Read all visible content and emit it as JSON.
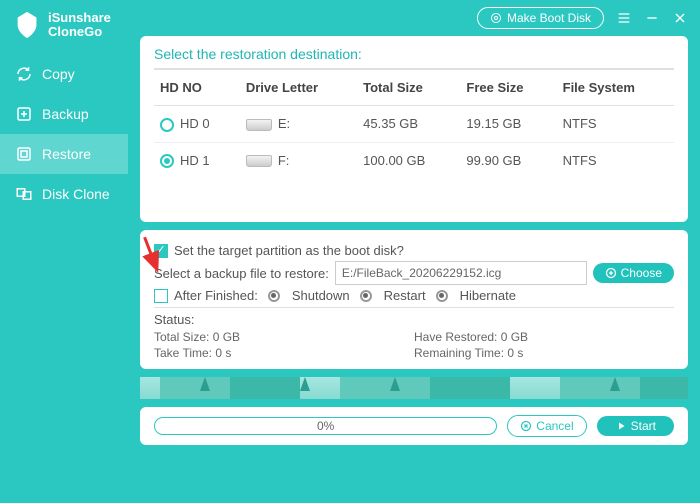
{
  "brand": {
    "line1": "iSunshare",
    "line2": "CloneGo"
  },
  "titlebar": {
    "make_boot": "Make Boot Disk"
  },
  "sidebar": {
    "items": [
      {
        "label": "Copy"
      },
      {
        "label": "Backup"
      },
      {
        "label": "Restore"
      },
      {
        "label": "Disk Clone"
      }
    ]
  },
  "dest_panel": {
    "title": "Select the restoration destination:",
    "columns": [
      "HD NO",
      "Drive Letter",
      "Total Size",
      "Free Size",
      "File System"
    ],
    "rows": [
      {
        "hd": "HD 0",
        "letter": "E:",
        "total": "45.35 GB",
        "free": "19.15 GB",
        "fs": "NTFS",
        "selected": false
      },
      {
        "hd": "HD 1",
        "letter": "F:",
        "total": "100.00 GB",
        "free": "99.90 GB",
        "fs": "NTFS",
        "selected": true
      }
    ]
  },
  "options": {
    "boot_q": "Set the target partition as the boot disk?",
    "select_backup": "Select a backup file to restore:",
    "file_value": "E:/FileBack_20206229152.icg",
    "choose": "Choose",
    "after_finished": "After Finished:",
    "actions": [
      "Shutdown",
      "Restart",
      "Hibernate"
    ],
    "status_label": "Status:",
    "status": {
      "total": "Total Size: 0 GB",
      "have": "Have Restored: 0 GB",
      "take": "Take Time: 0 s",
      "remain": "Remaining Time: 0 s"
    }
  },
  "progress": {
    "text": "0%",
    "cancel": "Cancel",
    "start": "Start"
  }
}
